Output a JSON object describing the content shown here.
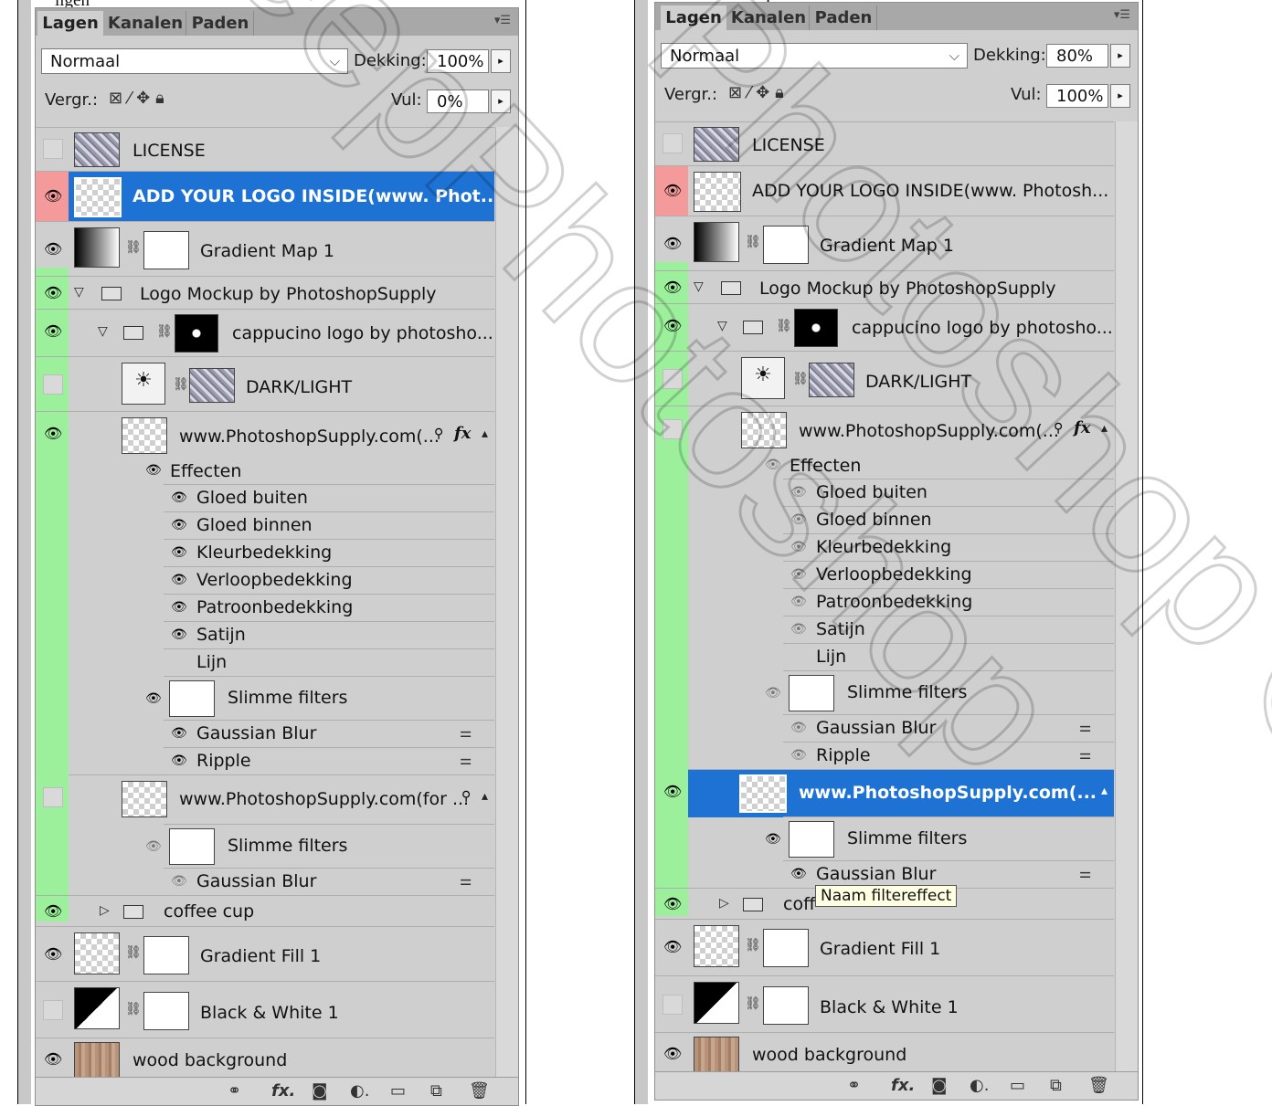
{
  "caption": {
    "left": "ligen",
    "right": ")"
  },
  "panels": [
    {
      "tabs": [
        "Lagen",
        "Kanalen",
        "Paden"
      ],
      "blend_mode": "Normaal",
      "opacity_label": "Dekking:",
      "opacity_value": "100%",
      "lock_label": "Vergr.:",
      "fill_label": "Vul:",
      "fill_value": "0%",
      "layers": {
        "license": "LICENSE",
        "logo_inside": "ADD YOUR LOGO INSIDE(www. Phot...",
        "gradient_map": "Gradient Map 1",
        "group_logo_mockup": "Logo Mockup by PhotoshopSupply",
        "group_cappucino": "cappucino logo by photosho...",
        "dark_light": "DARK/LIGHT",
        "smart_object_1": "www.PhotoshopSupply.com(...",
        "effects_label": "Effecten",
        "effects": [
          "Gloed buiten",
          "Gloed binnen",
          "Kleurbedekking",
          "Verloopbedekking",
          "Patroonbedekking",
          "Satijn",
          "Lijn"
        ],
        "smart_filters_1": "Slimme filters",
        "filters_1": [
          "Gaussian Blur",
          "Ripple"
        ],
        "smart_object_2": "www.PhotoshopSupply.com(for ...",
        "smart_filters_2": "Slimme filters",
        "filters_2": [
          "Gaussian Blur"
        ],
        "group_coffee": "coffee cup",
        "gradient_fill": "Gradient Fill 1",
        "black_white": "Black & White 1",
        "wood": "wood background"
      }
    },
    {
      "tabs": [
        "Lagen",
        "Kanalen",
        "Paden"
      ],
      "blend_mode": "Normaal",
      "opacity_label": "Dekking:",
      "opacity_value": "80%",
      "lock_label": "Vergr.:",
      "fill_label": "Vul:",
      "fill_value": "100%",
      "layers": {
        "license": "LICENSE",
        "logo_inside": "ADD YOUR LOGO INSIDE(www. Photosh...",
        "gradient_map": "Gradient Map 1",
        "group_logo_mockup": "Logo Mockup by PhotoshopSupply",
        "group_cappucino": "cappucino logo by photosho...",
        "dark_light": "DARK/LIGHT",
        "smart_object_1": "www.PhotoshopSupply.com(...",
        "effects_label": "Effecten",
        "effects": [
          "Gloed buiten",
          "Gloed binnen",
          "Kleurbedekking",
          "Verloopbedekking",
          "Patroonbedekking",
          "Satijn",
          "Lijn"
        ],
        "smart_filters_1": "Slimme filters",
        "filters_1": [
          "Gaussian Blur",
          "Ripple"
        ],
        "smart_object_2": "www.PhotoshopSupply.com(...",
        "smart_filters_2": "Slimme filters",
        "filters_2": [
          "Gaussian Blur"
        ],
        "group_coffee": "coff",
        "gradient_fill": "Gradient Fill 1",
        "black_white": "Black & White 1",
        "wood": "wood background"
      },
      "tooltip": "Naam filtereffect"
    }
  ],
  "colors": {
    "selection": "#1d72d4",
    "visible_green": "#9cf09c",
    "visible_red": "#f59a9a"
  },
  "watermark": {
    "left": "eepPhotoshop",
    "right": "Photoshop ©"
  }
}
